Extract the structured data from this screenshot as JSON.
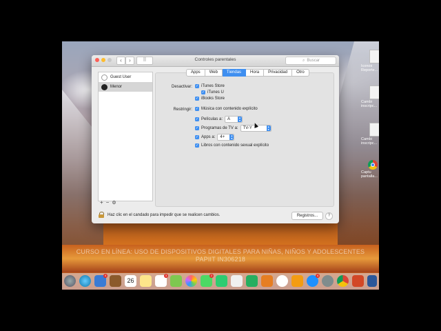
{
  "window": {
    "title": "Controles parentales",
    "search_placeholder": "Buscar"
  },
  "users": [
    {
      "name": "Guest User",
      "selected": false
    },
    {
      "name": "Menor",
      "selected": true
    }
  ],
  "list_buttons": {
    "add": "+",
    "remove": "−",
    "settings": "⚙"
  },
  "tabs": [
    "Apps",
    "Web",
    "Tiendas",
    "Hora",
    "Privacidad",
    "Otro"
  ],
  "active_tab": "Tiendas",
  "desactivar": {
    "label": "Desactivar:",
    "items": [
      "iTunes Store",
      "iTunes U",
      "iBooks Store"
    ]
  },
  "restringir": {
    "label": "Restringir:",
    "musica": "Música con contenido explícito",
    "peliculas_label": "Películas a:",
    "peliculas_value": "A",
    "tv_label": "Programas de TV a:",
    "tv_value": "TV-Y",
    "apps_label": "Apps a:",
    "apps_value": "4+",
    "libros": "Libros con contenido sexual explícito"
  },
  "footer": {
    "lock_text": "Haz clic en el candado para impedir que se realicen cambios.",
    "registros": "Registros...",
    "help": "?"
  },
  "watermark": {
    "line1": "CURSO EN LÍNEA: USO DE DISPOSITIVOS DIGITALES PARA NIÑAS, NIÑOS Y ADOLESCENTES",
    "line2": "PAPIIT IN306218"
  },
  "desktop": [
    {
      "label": "Iconos Reporte...",
      "kind": "doc"
    },
    {
      "label": "Cambi inscripc...",
      "kind": "doc"
    },
    {
      "label": "Cambi inscripc...",
      "kind": "doc"
    },
    {
      "label": "Captu pantalla...",
      "kind": "chrome"
    }
  ],
  "dock": {
    "calendar_day": "26",
    "badges": [
      "4",
      "3",
      "2",
      "4"
    ]
  },
  "colors": {
    "accent": "#3f8ff0"
  }
}
